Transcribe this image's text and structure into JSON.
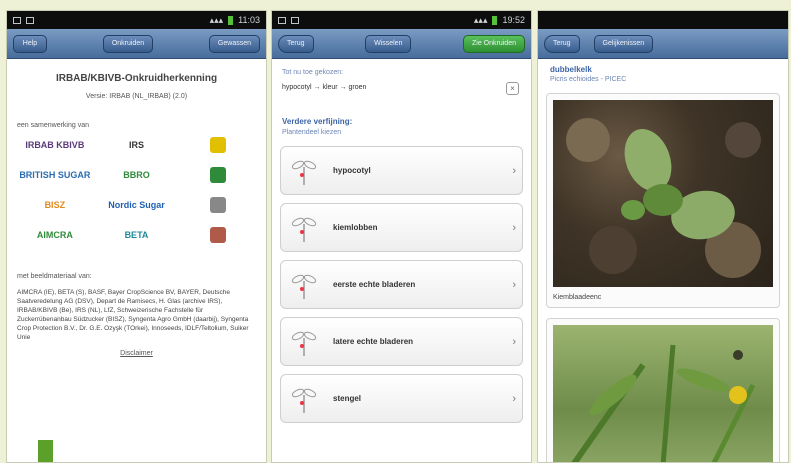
{
  "panel1": {
    "status": {
      "time": "11:03"
    },
    "nav": {
      "left": "Help",
      "middle": "Onkruiden",
      "right": "Gewassen"
    },
    "title": "IRBAB/KBIVB-Onkruidherkenning",
    "version": "Versie: IRBAB (NL_IRBAB) (2.0)",
    "collab_label": "een samenwerking van",
    "logos": [
      {
        "name": "IRBAB KBIVB",
        "color": "#5b3a7a"
      },
      {
        "name": "IRS",
        "color": "#333333"
      },
      {
        "name": "",
        "color": "#e0c000"
      },
      {
        "name": "BRITISH SUGAR",
        "color": "#2b6cb0"
      },
      {
        "name": "BBRO",
        "color": "#2f8a3a"
      },
      {
        "name": "",
        "color": "#2f8a3a"
      },
      {
        "name": "BISZ",
        "color": "#e08a1e"
      },
      {
        "name": "Nordic Sugar",
        "color": "#1f5fb3"
      },
      {
        "name": "",
        "color": "#888888"
      },
      {
        "name": "AIMCRA",
        "color": "#2f8a3a"
      },
      {
        "name": "BETA",
        "color": "#1f8a9a"
      },
      {
        "name": "",
        "color": "#b05a4a"
      }
    ],
    "sponsors_label": "met beeldmateriaal van:",
    "sponsors_text": "AIMCRA (IE), BETA (S), BASF, Bayer CropScience BV, BAYER, Deutsche Saatveredelung AG (DSV), Depart de Ramisecs, H. Glas (archive IRS), IRBAB/KBIVB (Be), IRS (NL), LfZ, Schweizerische Fachstelle für Zuckerrübenanbau Südzucker (BISZ), Syngenta Agro GmbH (daarbij), Syngenta Crop Protection B.V., Dr. G.E. Ozyşk (TOrkei), Innoseeds, IDLF/Teltolium, Suiker Unie",
    "disclaimer": "Disclaimer"
  },
  "panel2": {
    "status": {
      "time": "19:52"
    },
    "nav": {
      "back": "Terug",
      "middle": "Wisselen",
      "right": "Zie Onkruiden"
    },
    "chosen_label": "Tot nu toe gekozen:",
    "chosen_value": "hypocotyl → kleur → groen",
    "clear_icon": "×",
    "refine_title": "Verdere verfijning:",
    "refine_sub": "Plantendeel kiezen",
    "options": [
      "hypocotyl",
      "kiemlobben",
      "eerste echte bladeren",
      "latere echte bladeren",
      "stengel"
    ]
  },
  "panel3": {
    "nav": {
      "back": "Terug",
      "middle": "Gelijkenissen"
    },
    "species_name": "dubbelkelk",
    "species_latin": "Picris echioides - PICEC",
    "photo_caption": "Kiemblaadeenc",
    "accent": "#3d64a6"
  }
}
